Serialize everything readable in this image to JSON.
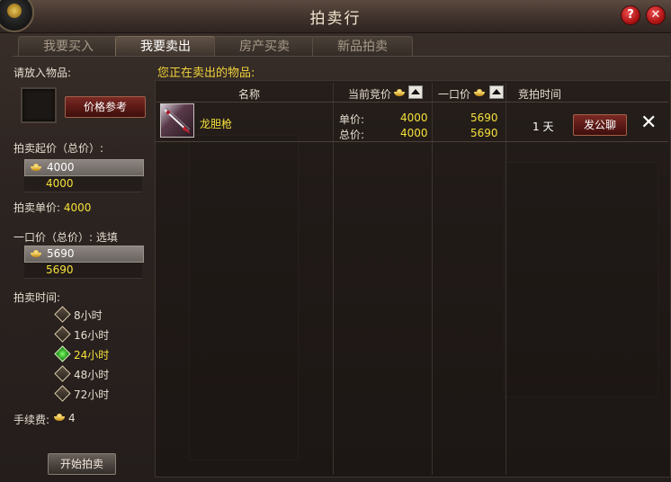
{
  "window": {
    "title": "拍卖行"
  },
  "titlebar": {
    "help_label": "?",
    "close_label": "✕"
  },
  "tabs": [
    {
      "label": "我要买入",
      "active": false
    },
    {
      "label": "我要卖出",
      "active": true
    },
    {
      "label": "房产买卖",
      "active": false
    },
    {
      "label": "新品拍卖",
      "active": false
    }
  ],
  "left": {
    "place_item_label": "请放入物品:",
    "price_ref_button": "价格参考",
    "start_price_label": "拍卖起价（总价）:",
    "start_price_input": "4000",
    "start_price_sub": "4000",
    "unit_price_label": "拍卖单价:",
    "unit_price_value": "4000",
    "buyout_label": "一口价（总价）:",
    "buyout_optional": "选填",
    "buyout_input": "5690",
    "buyout_sub": "5690",
    "duration_label": "拍卖时间:",
    "durations": [
      {
        "label": "8小时",
        "selected": false
      },
      {
        "label": "16小时",
        "selected": false
      },
      {
        "label": "24小时",
        "selected": true
      },
      {
        "label": "48小时",
        "selected": false
      },
      {
        "label": "72小时",
        "selected": false
      }
    ],
    "fee_label": "手续费:",
    "fee_value": "4",
    "start_button": "开始拍卖"
  },
  "right": {
    "section_title": "您正在卖出的物品:",
    "columns": {
      "name": "名称",
      "current_bid": "当前竞价",
      "buyout": "一口价",
      "time": "竞拍时间"
    },
    "rows": [
      {
        "name": "龙胆枪",
        "unit_label": "单价:",
        "unit_bid": "4000",
        "total_label": "总价:",
        "total_bid": "4000",
        "unit_buyout": "5690",
        "total_buyout": "5690",
        "time": "1 天",
        "action": "发公聊",
        "remove": "✕"
      }
    ]
  },
  "colors": {
    "accent_yellow": "#f6e13b",
    "title_yellow": "#f0d23a",
    "button_red": "#5a1915"
  }
}
